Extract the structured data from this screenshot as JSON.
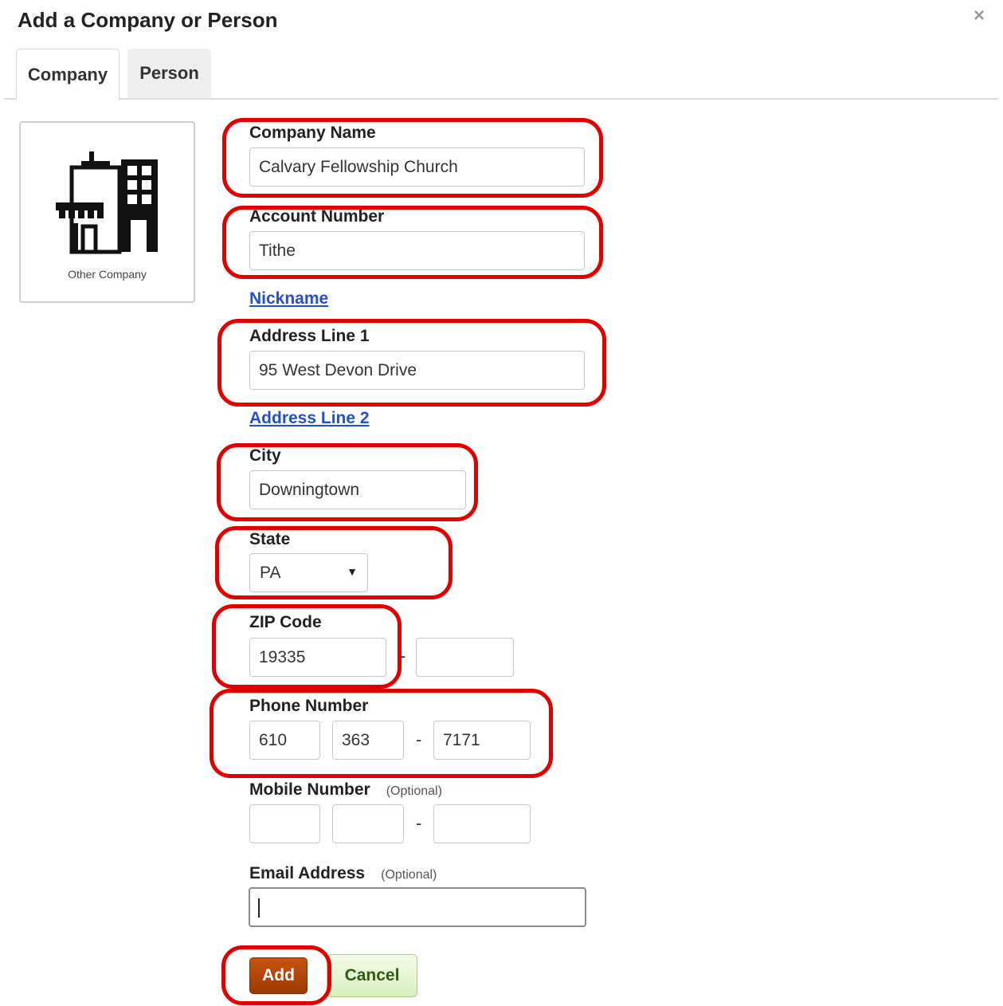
{
  "dialog": {
    "title": "Add a Company or Person",
    "close_label": "×"
  },
  "tabs": [
    {
      "label": "Company",
      "active": true
    },
    {
      "label": "Person",
      "active": false
    }
  ],
  "logo": {
    "icon": "building-icon",
    "caption": "Other Company"
  },
  "form": {
    "company_name": {
      "label": "Company Name",
      "value": "Calvary Fellowship Church"
    },
    "account_number": {
      "label": "Account Number",
      "value": "Tithe"
    },
    "nickname_link": "Nickname",
    "address_line1": {
      "label": "Address Line 1",
      "value": "95 West Devon Drive"
    },
    "address_line2_link": "Address Line 2",
    "city": {
      "label": "City",
      "value": "Downingtown"
    },
    "state": {
      "label": "State",
      "value": "PA",
      "arrow": "▼"
    },
    "zip": {
      "label": "ZIP Code",
      "value": "19335",
      "ext_value": "",
      "separator": "-"
    },
    "phone": {
      "label": "Phone Number",
      "area": "610",
      "prefix": "363",
      "line": "7171",
      "separator": "-"
    },
    "mobile": {
      "label": "Mobile Number",
      "optional": "(Optional)",
      "area": "",
      "prefix": "",
      "line": "",
      "separator": "-"
    },
    "email": {
      "label": "Email Address",
      "optional": "(Optional)",
      "value": ""
    }
  },
  "buttons": {
    "add": "Add",
    "cancel": "Cancel"
  },
  "colors": {
    "annotation": "#e10000",
    "add_button": "#b4470a",
    "cancel_button": "#d8f0c0",
    "link": "#2450c8"
  }
}
